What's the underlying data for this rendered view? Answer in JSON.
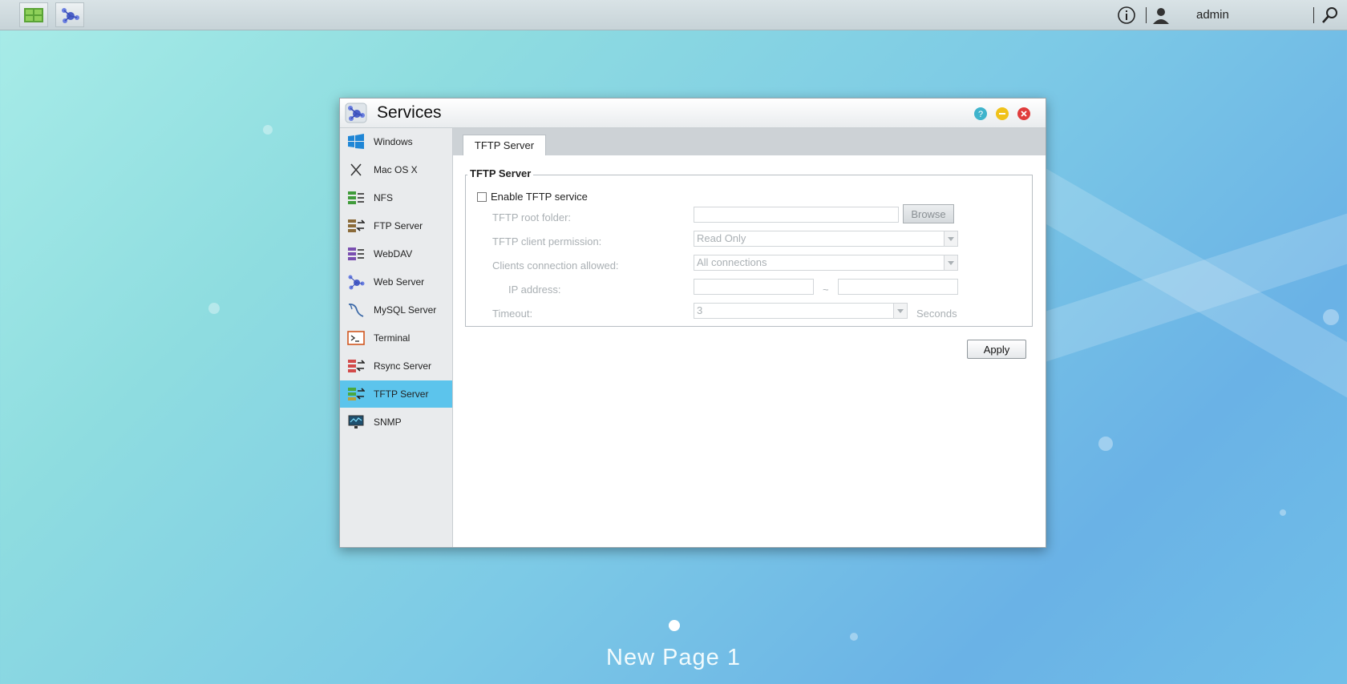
{
  "taskbar": {
    "user": "admin",
    "icons": [
      "storage-app-icon",
      "services-app-icon",
      "info-icon",
      "user-icon",
      "search-icon"
    ]
  },
  "window": {
    "title": "Services",
    "controls": [
      "help-icon",
      "minimize-icon",
      "close-icon"
    ]
  },
  "sidebar": {
    "items": [
      {
        "label": "Windows",
        "icon": "windows-icon"
      },
      {
        "label": "Mac OS X",
        "icon": "macos-icon"
      },
      {
        "label": "NFS",
        "icon": "nfs-icon"
      },
      {
        "label": "FTP Server",
        "icon": "ftp-server-icon"
      },
      {
        "label": "WebDAV",
        "icon": "webdav-icon"
      },
      {
        "label": "Web Server",
        "icon": "web-server-icon"
      },
      {
        "label": "MySQL Server",
        "icon": "mysql-server-icon"
      },
      {
        "label": "Terminal",
        "icon": "terminal-icon"
      },
      {
        "label": "Rsync Server",
        "icon": "rsync-server-icon"
      },
      {
        "label": "TFTP Server",
        "icon": "tftp-server-icon",
        "active": true
      },
      {
        "label": "SNMP",
        "icon": "snmp-icon"
      }
    ]
  },
  "tabs": [
    {
      "label": "TFTP Server"
    }
  ],
  "form": {
    "section_title": "TFTP Server",
    "enable_label": "Enable TFTP service",
    "enable_checked": false,
    "root_folder_label": "TFTP root folder:",
    "root_folder_value": "",
    "browse_label": "Browse",
    "client_permission_label": "TFTP client permission:",
    "client_permission_value": "Read Only",
    "connections_label": "Clients connection allowed:",
    "connections_value": "All connections",
    "ip_label": "IP address:",
    "ip_separator": "~",
    "ip_from": "",
    "ip_to": "",
    "timeout_label": "Timeout:",
    "timeout_value": "3",
    "timeout_unit": "Seconds",
    "apply_label": "Apply"
  },
  "desktop": {
    "page_label": "New Page 1"
  },
  "colors": {
    "active_item": "#5cc4ec",
    "disabled_text": "#aab0b4",
    "help_button": "#3fb4cc",
    "minimize_button": "#f0c21a",
    "close_button": "#e03c3c"
  }
}
